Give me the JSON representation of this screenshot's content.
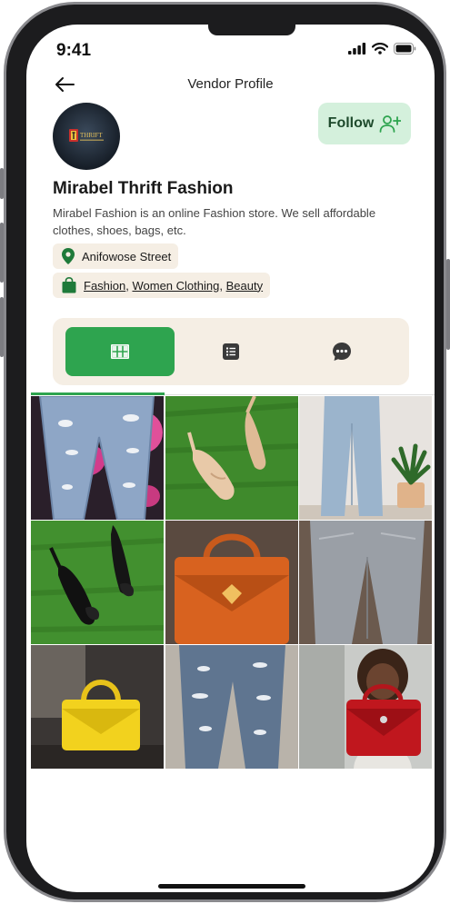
{
  "status_bar": {
    "time": "9:41"
  },
  "header": {
    "title": "Vendor Profile"
  },
  "vendor": {
    "name": "Mirabel Thrift Fashion",
    "description": "Mirabel Fashion is an online Fashion store. We sell affordable clothes, shoes, bags, etc.",
    "avatar_text": "THRIFT",
    "location": "Anifowose Street",
    "categories": [
      "Fashion",
      "Women Clothing",
      "Beauty"
    ]
  },
  "follow": {
    "label": "Follow"
  },
  "tabs": [
    {
      "icon": "grid-icon",
      "active": true
    },
    {
      "icon": "list-icon",
      "active": false
    },
    {
      "icon": "chat-icon",
      "active": false
    }
  ],
  "products": [
    {
      "icon": "ripped-jeans-photo"
    },
    {
      "icon": "nude-heels-photo"
    },
    {
      "icon": "wide-leg-jeans-photo"
    },
    {
      "icon": "black-heels-photo"
    },
    {
      "icon": "orange-handbag-photo"
    },
    {
      "icon": "grey-jeans-photo"
    },
    {
      "icon": "yellow-handbag-photo"
    },
    {
      "icon": "distressed-jeans-photo"
    },
    {
      "icon": "red-handbag-photo"
    }
  ],
  "colors": {
    "accent": "#2ea44f",
    "chip_bg": "#f5eee4",
    "follow_bg": "#d4f0dc",
    "follow_text": "#1e4a2c"
  }
}
